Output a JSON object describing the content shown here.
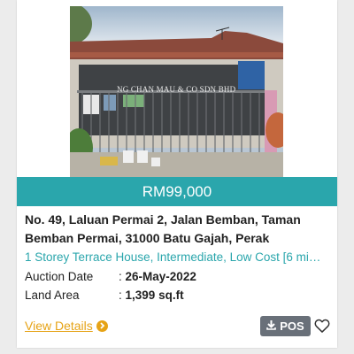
{
  "listing": {
    "photo_sign_text": "NG CHAN MAU & CO SDN BHD",
    "price": "RM99,000",
    "address": "No. 49, Laluan Permai 2, Jalan Bemban, Taman Bemban Permai, 31000 Batu Gajah, Perak",
    "property_type": "1 Storey Terrace House, Intermediate, Low Cost [6 mi…",
    "auction_date_label": "Auction Date",
    "auction_date_value": "26-May-2022",
    "land_area_label": "Land Area",
    "land_area_value": "1,399 sq.ft",
    "separator": ":"
  },
  "actions": {
    "view_details_label": "View Details",
    "pos_label": "POS",
    "pos_icon": "download-icon",
    "favorite_icon": "heart-icon",
    "view_details_icon": "chevron-right-icon"
  },
  "colors": {
    "accent": "#2aa6ac",
    "link": "#e6a316",
    "pos_button": "#697079"
  }
}
